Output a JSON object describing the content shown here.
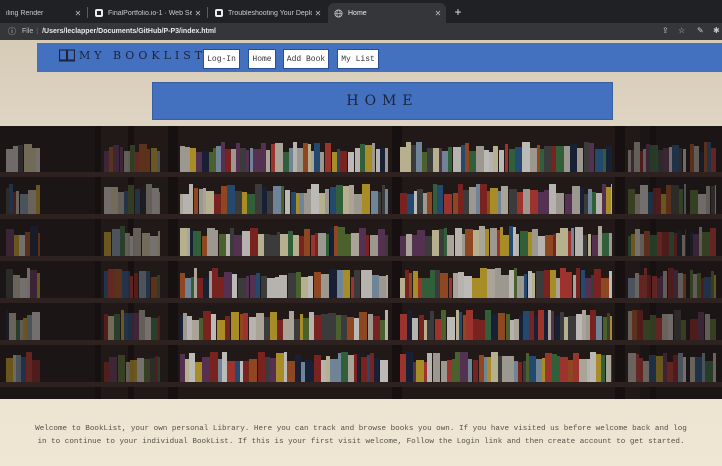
{
  "browser": {
    "tabs": [
      {
        "title": "iling Render",
        "active": false
      },
      {
        "title": "FinalPortfolio.io-1 · Web Ser",
        "active": false
      },
      {
        "title": "Troubleshooting Your Deploy |",
        "active": false
      },
      {
        "title": "Home",
        "active": true
      }
    ],
    "new_tab": "+",
    "address": {
      "scheme": "File",
      "path": "/Users/leclapper/Documents/GitHub/P-P3/index.html"
    }
  },
  "site": {
    "brand": "MY BOOKLIST",
    "nav": [
      "Log-In",
      "Home",
      "Add Book",
      "My List"
    ],
    "banner_title": "HOME",
    "welcome_text": "Welcome to BookList, your own personal Library. Here you can track and browse books you own. If you have visited us before welcome back and log in to continue to your individual BookList. If this is your first visit welcome, Follow the Login link and then create account to get started."
  },
  "colors": {
    "navbar": "#4470c0",
    "page_background": "#e6ddcb",
    "browser_chrome": "#202124"
  }
}
